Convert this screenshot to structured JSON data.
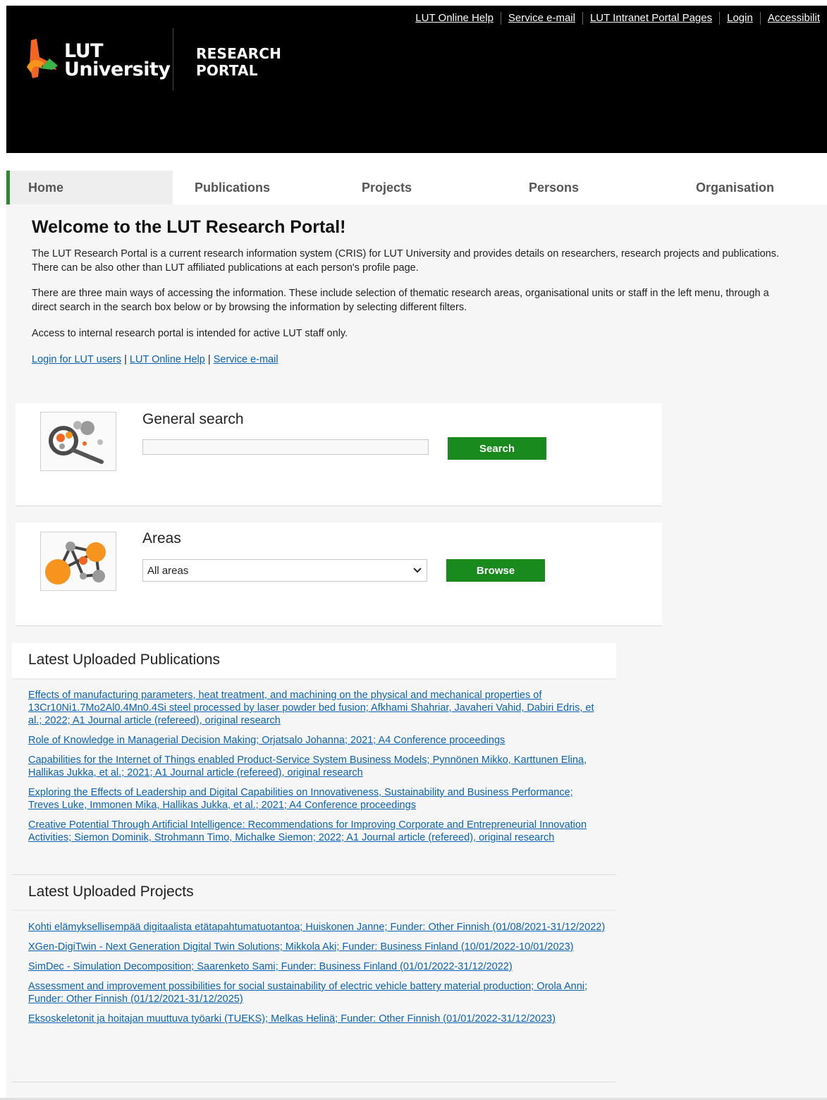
{
  "header": {
    "top_links": [
      "LUT Online Help",
      "Service e-mail",
      "LUT Intranet Portal Pages",
      "Login",
      "Accessibilit"
    ],
    "logo_line1": "LUT",
    "logo_line2": "University",
    "portal_line1": "RESEARCH",
    "portal_line2": "PORTAL"
  },
  "nav": {
    "tabs": [
      "Home",
      "Publications",
      "Projects",
      "Persons",
      "Organisation"
    ],
    "active": "Home"
  },
  "welcome": {
    "title": "Welcome to the LUT Research Portal!",
    "p1": "The LUT Research Portal is a current research information system (CRIS) for LUT University and provides details on researchers, research projects and publications. There can be also other than LUT affiliated publications at each person's profile page.",
    "p2": "There are three main ways of accessing the information. These include selection of thematic research areas, organisational units or staff in the left menu, through a direct search in the search box below or by browsing the information by selecting different filters.",
    "p3": "Access to internal research portal is intended for active LUT staff only.",
    "links": [
      "Login for LUT users",
      "LUT Online Help",
      "Service e-mail"
    ],
    "link_sep": "|"
  },
  "search": {
    "title": "General search",
    "value": "",
    "button": "Search"
  },
  "areas": {
    "title": "Areas",
    "selected": "All areas",
    "button": "Browse"
  },
  "publications": {
    "title": "Latest Uploaded Publications",
    "items": [
      "Effects of manufacturing parameters, heat treatment, and machining on the physical and mechanical properties of 13Cr10Ni1.7Mo2Al0.4Mn0.4Si steel processed by laser powder bed fusion; Afkhami Shahriar, Javaheri Vahid, Dabiri Edris, et al.; 2022; A1 Journal article (refereed), original research",
      "Role of Knowledge in Managerial Decision Making; Orjatsalo Johanna; 2021; A4 Conference proceedings",
      "Capabilities for the Internet of Things enabled Product-Service System Business Models; Pynnönen Mikko, Karttunen Elina, Hallikas Jukka, et al.; 2021; A1 Journal article (refereed), original research",
      "Exploring the Effects of Leadership and Digital Capabilities on Innovativeness, Sustainability and Business Performance; Treves Luke, Immonen Mika, Hallikas Jukka, et al.; 2021; A4 Conference proceedings",
      "Creative Potential Through Artificial Intelligence: Recommendations for Improving Corporate and Entrepreneurial Innovation Activities; Siemon Dominik, Strohmann Timo, Michalke Siemon; 2022; A1 Journal article (refereed), original research"
    ]
  },
  "projects": {
    "title": "Latest Uploaded Projects",
    "items": [
      "Kohti elämyksellisempää digitaalista etätapahtumatuotantoa; Huiskonen Janne; Funder: Other Finnish (01/08/2021-31/12/2022)",
      "XGen-DigiTwin - Next Generation Digital Twin Solutions; Mikkola Aki; Funder: Business Finland (10/01/2022-10/01/2023)",
      "SimDec - Simulation Decomposition; Saarenketo Sami; Funder: Business Finland (01/01/2022-31/12/2022)",
      "Assessment and improvement possibilities for social sustainability of electric vehicle battery material production; Orola Anni; Funder: Other Finnish (01/12/2021-31/12/2025)",
      "Eksoskeletonit ja hoitajan muuttuva työarki (TUEKS); Melkas Helinä; Funder: Other Finnish (01/01/2022-31/12/2023)"
    ]
  },
  "colors": {
    "header_bg": "#000000",
    "accent_green": "#198a1e",
    "link": "#0b63b5",
    "logo_orange": "#f26522",
    "logo_green": "#39b54a"
  }
}
